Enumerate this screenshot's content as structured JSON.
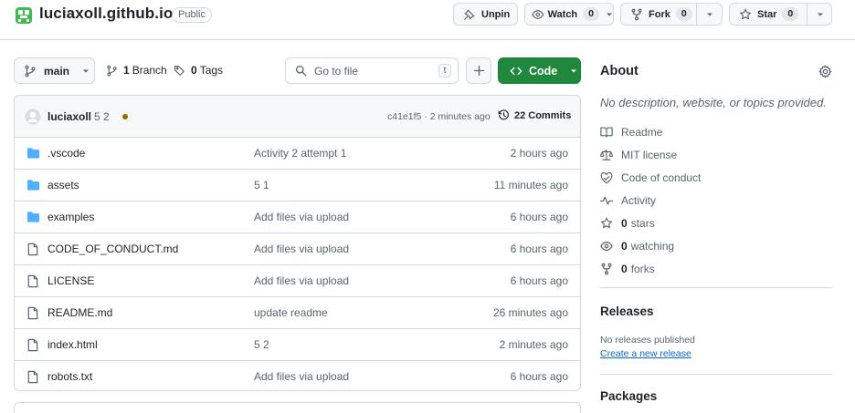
{
  "repo": {
    "name": "luciaxoll.github.io",
    "visibility": "Public"
  },
  "actions": {
    "unpin_label": "Unpin",
    "watch_label": "Watch",
    "watch_count": "0",
    "fork_label": "Fork",
    "fork_count": "0",
    "star_label": "Star",
    "star_count": "0"
  },
  "toolbar": {
    "branch": "main",
    "branches_count": "1",
    "branches_label": "Branch",
    "tags_count": "0",
    "tags_label": "Tags",
    "search_placeholder": "Go to file",
    "search_shortcut": "t",
    "code_label": "Code"
  },
  "commit": {
    "author": "luciaxoll",
    "message": "5 2",
    "hash_time": "c41e1f5 · 2 minutes ago",
    "commits_count": "22",
    "commits_label": "Commits",
    "status_color": "#9a6700"
  },
  "files": [
    {
      "name": ".vscode",
      "type": "folder",
      "message": "Activity 2 attempt 1",
      "time": "2 hours ago"
    },
    {
      "name": "assets",
      "type": "folder",
      "message": "5 1",
      "time": "11 minutes ago"
    },
    {
      "name": "examples",
      "type": "folder",
      "message": "Add files via upload",
      "time": "6 hours ago"
    },
    {
      "name": "CODE_OF_CONDUCT.md",
      "type": "file",
      "message": "Add files via upload",
      "time": "6 hours ago"
    },
    {
      "name": "LICENSE",
      "type": "file",
      "message": "Add files via upload",
      "time": "6 hours ago"
    },
    {
      "name": "README.md",
      "type": "file",
      "message": "update readme",
      "time": "26 minutes ago"
    },
    {
      "name": "index.html",
      "type": "file",
      "message": "5 2",
      "time": "2 minutes ago"
    },
    {
      "name": "robots.txt",
      "type": "file",
      "message": "Add files via upload",
      "time": "6 hours ago"
    }
  ],
  "about": {
    "title": "About",
    "description": "No description, website, or topics provided.",
    "links": [
      {
        "label": "Readme",
        "icon": "book-icon"
      },
      {
        "label": "MIT license",
        "icon": "law-icon"
      },
      {
        "label": "Code of conduct",
        "icon": "code-of-conduct-icon"
      },
      {
        "label": "Activity",
        "icon": "pulse-icon"
      }
    ],
    "stats": [
      {
        "count": "0",
        "label": "stars",
        "icon": "star-icon"
      },
      {
        "count": "0",
        "label": "watching",
        "icon": "eye-icon"
      },
      {
        "count": "0",
        "label": "forks",
        "icon": "fork-icon"
      }
    ]
  },
  "releases": {
    "title": "Releases",
    "empty_text": "No releases published",
    "create_link": "Create a new release"
  },
  "packages": {
    "title": "Packages"
  },
  "colors": {
    "primary_green": "#1f883d",
    "folder_blue": "#54aeff",
    "link_blue": "#0969da",
    "avatar_green": "#3fb950"
  }
}
